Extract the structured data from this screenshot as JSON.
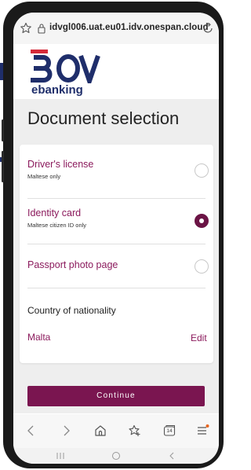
{
  "browser": {
    "url": "idvgl006.uat.eu01.idv.onespan.cloud"
  },
  "brand": {
    "logo_text": "BOV",
    "sub_text": "ebanking",
    "primary_color": "#8b1a5c",
    "dark_accent": "#6b1445",
    "logo_color": "#1f2e6b",
    "logo_red": "#d62b3a"
  },
  "page": {
    "title": "Document selection"
  },
  "options": [
    {
      "title": "Driver's license",
      "subtitle": "Maltese only",
      "selected": false
    },
    {
      "title": "Identity card",
      "subtitle": "Maltese citizen ID only",
      "selected": true
    },
    {
      "title": "Passport photo page",
      "subtitle": "",
      "selected": false
    }
  ],
  "nationality": {
    "label": "Country of nationality",
    "value": "Malta",
    "edit_label": "Edit"
  },
  "actions": {
    "continue_label": "Continue"
  },
  "toolbar": {
    "icons": [
      "back-icon",
      "forward-icon",
      "home-icon",
      "bookmark-icon",
      "tabs-icon",
      "menu-icon"
    ],
    "tab_count": "14"
  },
  "system_nav": {
    "icons": [
      "recent-apps-icon",
      "home-circle-icon",
      "system-back-icon"
    ]
  }
}
